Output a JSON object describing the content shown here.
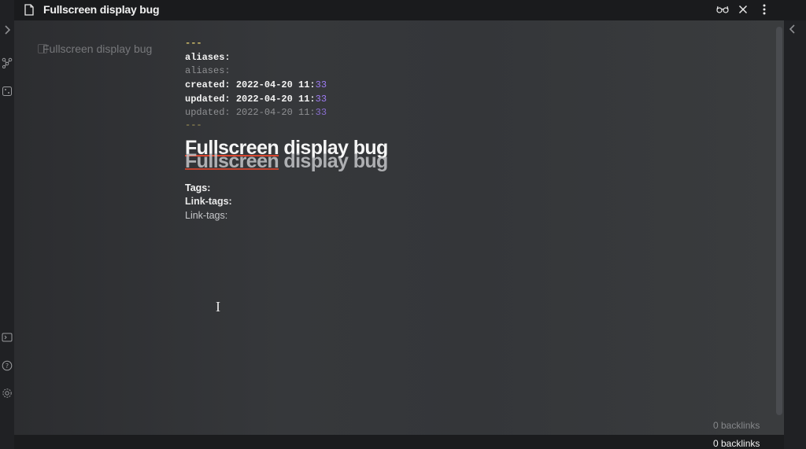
{
  "titlebar": {
    "title": "Fullscreen display bug",
    "icons": [
      "file-icon",
      "reading-glasses-icon",
      "close-icon",
      "more-options-icon"
    ]
  },
  "ghost_header": {
    "title": "Fullscreen display bug"
  },
  "sidebar": {
    "icons": [
      "chevron-right-icon",
      "graph-view-icon",
      "random-note-icon",
      "command-palette-icon",
      "help-icon",
      "settings-icon"
    ]
  },
  "editor": {
    "frontmatter_open": "---",
    "aliases_key_bold": "aliases:",
    "aliases_key_faded": "aliases:",
    "created_label": "created:",
    "created_value": "2022-04-20 11:",
    "created_accent": "33",
    "updated_label": "updated:",
    "updated_value": "2022-04-20 11:",
    "updated_accent": "33",
    "updated_faded_label": "updated:",
    "updated_faded_value": "2022-04-20 11:",
    "updated_faded_accent": "33",
    "frontmatter_close": "---",
    "heading_word1": "Fullscreen",
    "heading_rest": " display bug",
    "heading_ghost_word1": "Fullscreen",
    "heading_ghost_rest": " display bug",
    "tags_label": "Tags:",
    "link_tags_bold": "Link-tags:",
    "link_tags_plain": "Link-tags:"
  },
  "footer": {
    "backlinks_ghost": "0 backlinks",
    "backlinks": "0 backlinks"
  },
  "colors": {
    "accent": "#9f7cf5",
    "frontmatter_dash": "#d6c26b",
    "spellcheck_underline": "#d8452e"
  }
}
